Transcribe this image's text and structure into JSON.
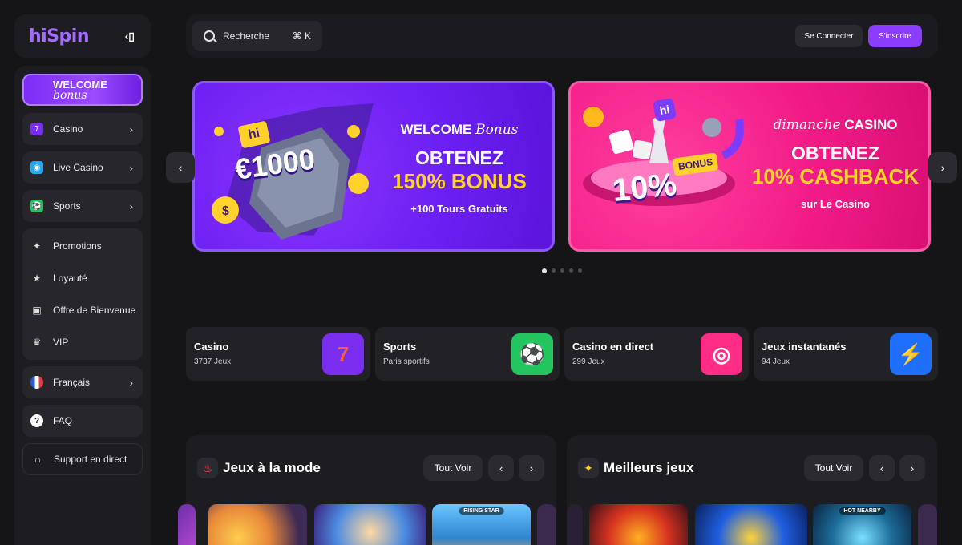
{
  "brand": {
    "logo_text": "hiSpin",
    "collapse_icon": "collapse-icon"
  },
  "topbar": {
    "search_placeholder": "Recherche",
    "search_shortcut": "⌘ K",
    "login_label": "Se Connecter",
    "signup_label": "S'inscrire"
  },
  "sidebar": {
    "welcome_line1": "WELCOME",
    "welcome_line2": "bonus",
    "items": [
      {
        "label": "Casino",
        "icon": "casino-icon"
      },
      {
        "label": "Live Casino",
        "icon": "live-casino-icon"
      },
      {
        "label": "Sports",
        "icon": "sports-icon"
      }
    ],
    "group": [
      {
        "label": "Promotions",
        "icon": "promotions-icon"
      },
      {
        "label": "Loyauté",
        "icon": "loyalty-icon"
      },
      {
        "label": "Offre de Bienvenue",
        "icon": "gift-icon"
      },
      {
        "label": "VIP",
        "icon": "crown-icon"
      }
    ],
    "language": "Français",
    "faq": "FAQ",
    "support": "Support en direct"
  },
  "banners": [
    {
      "top_bold": "WELCOME",
      "top_script": "Bonus",
      "line1": "OBTENEZ",
      "line2": "150% BONUS",
      "sub": "+100 Tours Gratuits",
      "art_text": "€1000",
      "art_badge": "hi"
    },
    {
      "top_script": "dimanche",
      "top_bold": "CASINO",
      "line1": "OBTENEZ",
      "line2": "10% CASHBACK",
      "sub": "sur Le Casino",
      "art_text": "10%",
      "art_badge": "BONUS"
    }
  ],
  "carousel": {
    "slides": 5,
    "active": 1
  },
  "categories": [
    {
      "title": "Casino",
      "sub": "3737 Jeux",
      "tile": "7",
      "color": "#7a2ff0"
    },
    {
      "title": "Sports",
      "sub": "Paris sportifs",
      "tile": "⚽",
      "color": "#22c55e"
    },
    {
      "title": "Casino en direct",
      "sub": "299 Jeux",
      "tile": "◎",
      "color": "#ff2d86"
    },
    {
      "title": "Jeux instantanés",
      "sub": "94 Jeux",
      "tile": "⚡",
      "color": "#1f6fff"
    }
  ],
  "sections": [
    {
      "title": "Jeux à la mode",
      "icon": "fire-icon",
      "all_label": "Tout Voir",
      "tags": [
        "",
        "",
        "RISING STAR"
      ]
    },
    {
      "title": "Meilleurs jeux",
      "icon": "sparkle-icon",
      "all_label": "Tout Voir",
      "tags": [
        "",
        "",
        "HOT NEARBY"
      ]
    }
  ]
}
